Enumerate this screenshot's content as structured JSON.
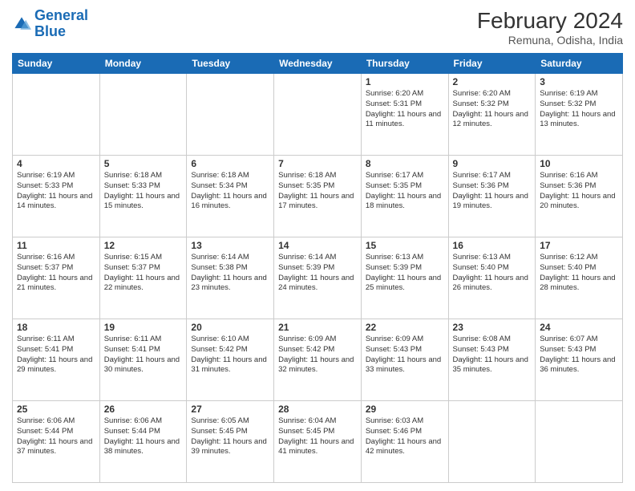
{
  "logo": {
    "line1": "General",
    "line2": "Blue"
  },
  "title": "February 2024",
  "subtitle": "Remuna, Odisha, India",
  "weekdays": [
    "Sunday",
    "Monday",
    "Tuesday",
    "Wednesday",
    "Thursday",
    "Friday",
    "Saturday"
  ],
  "weeks": [
    [
      {
        "day": "",
        "info": ""
      },
      {
        "day": "",
        "info": ""
      },
      {
        "day": "",
        "info": ""
      },
      {
        "day": "",
        "info": ""
      },
      {
        "day": "1",
        "info": "Sunrise: 6:20 AM\nSunset: 5:31 PM\nDaylight: 11 hours and 11 minutes."
      },
      {
        "day": "2",
        "info": "Sunrise: 6:20 AM\nSunset: 5:32 PM\nDaylight: 11 hours and 12 minutes."
      },
      {
        "day": "3",
        "info": "Sunrise: 6:19 AM\nSunset: 5:32 PM\nDaylight: 11 hours and 13 minutes."
      }
    ],
    [
      {
        "day": "4",
        "info": "Sunrise: 6:19 AM\nSunset: 5:33 PM\nDaylight: 11 hours and 14 minutes."
      },
      {
        "day": "5",
        "info": "Sunrise: 6:18 AM\nSunset: 5:33 PM\nDaylight: 11 hours and 15 minutes."
      },
      {
        "day": "6",
        "info": "Sunrise: 6:18 AM\nSunset: 5:34 PM\nDaylight: 11 hours and 16 minutes."
      },
      {
        "day": "7",
        "info": "Sunrise: 6:18 AM\nSunset: 5:35 PM\nDaylight: 11 hours and 17 minutes."
      },
      {
        "day": "8",
        "info": "Sunrise: 6:17 AM\nSunset: 5:35 PM\nDaylight: 11 hours and 18 minutes."
      },
      {
        "day": "9",
        "info": "Sunrise: 6:17 AM\nSunset: 5:36 PM\nDaylight: 11 hours and 19 minutes."
      },
      {
        "day": "10",
        "info": "Sunrise: 6:16 AM\nSunset: 5:36 PM\nDaylight: 11 hours and 20 minutes."
      }
    ],
    [
      {
        "day": "11",
        "info": "Sunrise: 6:16 AM\nSunset: 5:37 PM\nDaylight: 11 hours and 21 minutes."
      },
      {
        "day": "12",
        "info": "Sunrise: 6:15 AM\nSunset: 5:37 PM\nDaylight: 11 hours and 22 minutes."
      },
      {
        "day": "13",
        "info": "Sunrise: 6:14 AM\nSunset: 5:38 PM\nDaylight: 11 hours and 23 minutes."
      },
      {
        "day": "14",
        "info": "Sunrise: 6:14 AM\nSunset: 5:39 PM\nDaylight: 11 hours and 24 minutes."
      },
      {
        "day": "15",
        "info": "Sunrise: 6:13 AM\nSunset: 5:39 PM\nDaylight: 11 hours and 25 minutes."
      },
      {
        "day": "16",
        "info": "Sunrise: 6:13 AM\nSunset: 5:40 PM\nDaylight: 11 hours and 26 minutes."
      },
      {
        "day": "17",
        "info": "Sunrise: 6:12 AM\nSunset: 5:40 PM\nDaylight: 11 hours and 28 minutes."
      }
    ],
    [
      {
        "day": "18",
        "info": "Sunrise: 6:11 AM\nSunset: 5:41 PM\nDaylight: 11 hours and 29 minutes."
      },
      {
        "day": "19",
        "info": "Sunrise: 6:11 AM\nSunset: 5:41 PM\nDaylight: 11 hours and 30 minutes."
      },
      {
        "day": "20",
        "info": "Sunrise: 6:10 AM\nSunset: 5:42 PM\nDaylight: 11 hours and 31 minutes."
      },
      {
        "day": "21",
        "info": "Sunrise: 6:09 AM\nSunset: 5:42 PM\nDaylight: 11 hours and 32 minutes."
      },
      {
        "day": "22",
        "info": "Sunrise: 6:09 AM\nSunset: 5:43 PM\nDaylight: 11 hours and 33 minutes."
      },
      {
        "day": "23",
        "info": "Sunrise: 6:08 AM\nSunset: 5:43 PM\nDaylight: 11 hours and 35 minutes."
      },
      {
        "day": "24",
        "info": "Sunrise: 6:07 AM\nSunset: 5:43 PM\nDaylight: 11 hours and 36 minutes."
      }
    ],
    [
      {
        "day": "25",
        "info": "Sunrise: 6:06 AM\nSunset: 5:44 PM\nDaylight: 11 hours and 37 minutes."
      },
      {
        "day": "26",
        "info": "Sunrise: 6:06 AM\nSunset: 5:44 PM\nDaylight: 11 hours and 38 minutes."
      },
      {
        "day": "27",
        "info": "Sunrise: 6:05 AM\nSunset: 5:45 PM\nDaylight: 11 hours and 39 minutes."
      },
      {
        "day": "28",
        "info": "Sunrise: 6:04 AM\nSunset: 5:45 PM\nDaylight: 11 hours and 41 minutes."
      },
      {
        "day": "29",
        "info": "Sunrise: 6:03 AM\nSunset: 5:46 PM\nDaylight: 11 hours and 42 minutes."
      },
      {
        "day": "",
        "info": ""
      },
      {
        "day": "",
        "info": ""
      }
    ]
  ]
}
